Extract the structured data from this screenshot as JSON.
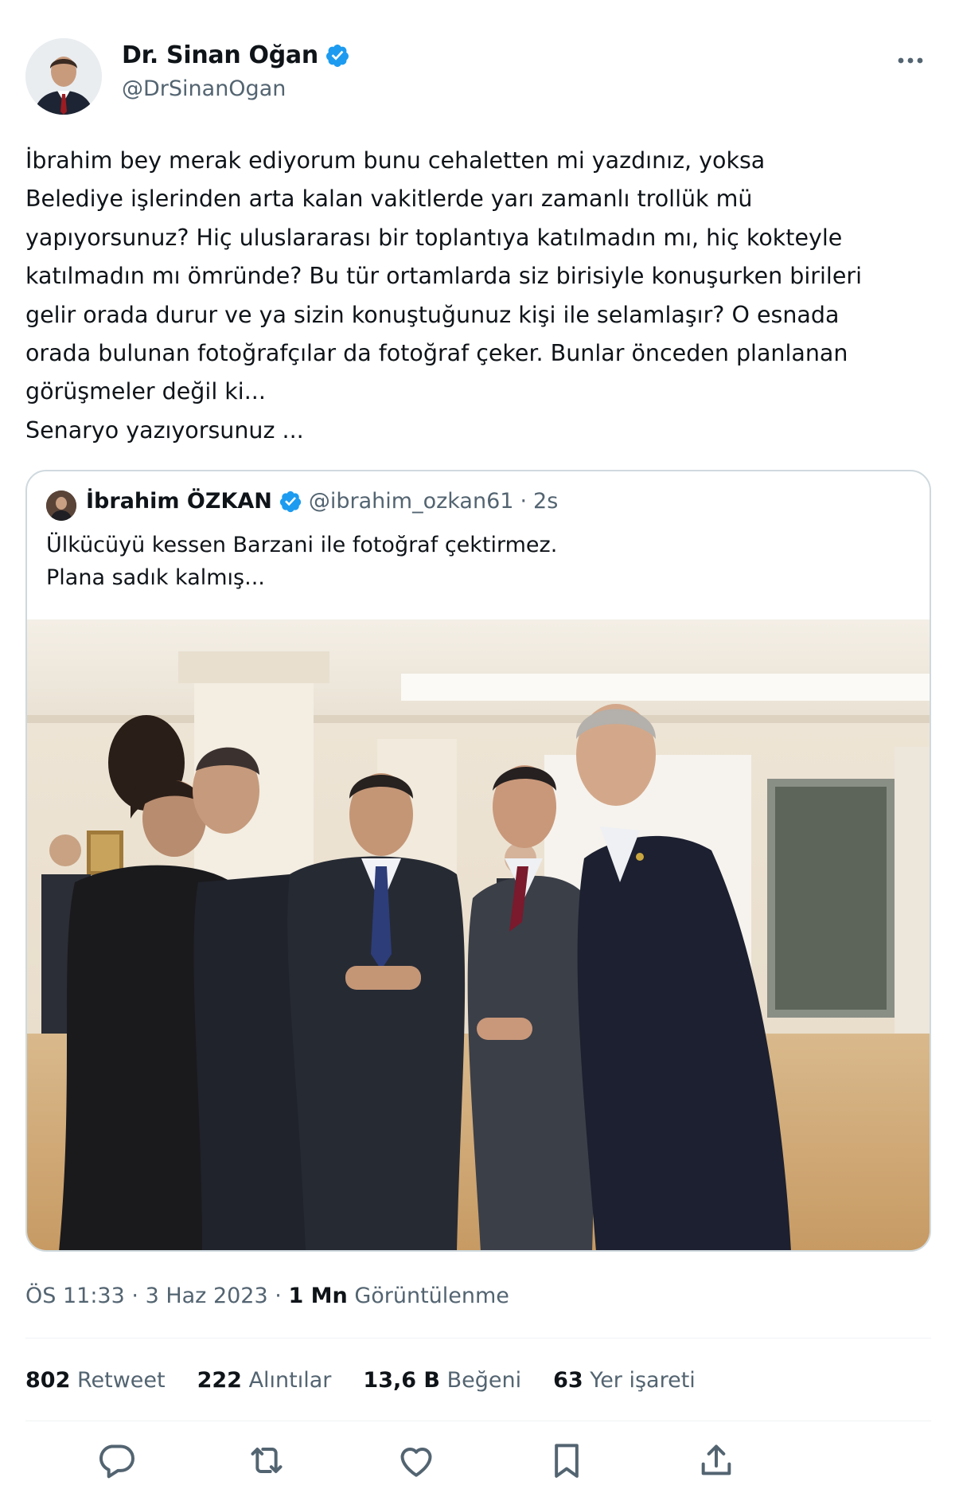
{
  "author": {
    "display_name": "Dr. Sinan Oğan",
    "handle": "@DrSinanOgan"
  },
  "tweet": {
    "lines": [
      "İbrahim bey merak ediyorum bunu cehaletten mi yazdınız, yoksa",
      "Belediye işlerinden arta kalan vakitlerde yarı zamanlı trollük mü",
      "yapıyorsunuz? Hiç uluslararası bir toplantıya katılmadın mı, hiç kokteyle",
      "katılmadın mı ömründe? Bu tür ortamlarda siz birisiyle konuşurken birileri",
      "gelir orada durur ve ya sizin konuştuğunuz kişi ile selamlaşır? O esnada",
      "orada bulunan fotoğrafçılar da fotoğraf çeker. Bunlar önceden planlanan",
      "görüşmeler değil ki...",
      "Senaryo yazıyorsunuz ..."
    ]
  },
  "quoted": {
    "display_name": "İbrahim ÖZKAN",
    "handle": "@ibrahim_ozkan61",
    "separator": "·",
    "time": "2s",
    "lines": [
      "Ülkücüyü kessen Barzani ile fotoğraf çektirmez.",
      "Plana sadık kalmış..."
    ]
  },
  "meta": {
    "time": "ÖS 11:33",
    "sep1": "·",
    "date": "3 Haz 2023",
    "sep2": "·",
    "views_count": "1 Mn",
    "views_label": "Görüntülenme"
  },
  "stats": [
    {
      "count": "802",
      "label": "Retweet"
    },
    {
      "count": "222",
      "label": "Alıntılar"
    },
    {
      "count": "13,6 B",
      "label": "Beğeni"
    },
    {
      "count": "63",
      "label": "Yer işareti"
    }
  ],
  "colors": {
    "verified": "#1d9bf0",
    "secondary_text": "#536471",
    "border": "#cfd9de"
  },
  "icons": {
    "more": "more-horizontal-icon",
    "reply": "reply-icon",
    "retweet": "retweet-icon",
    "like": "heart-icon",
    "bookmark": "bookmark-icon",
    "share": "share-icon"
  }
}
